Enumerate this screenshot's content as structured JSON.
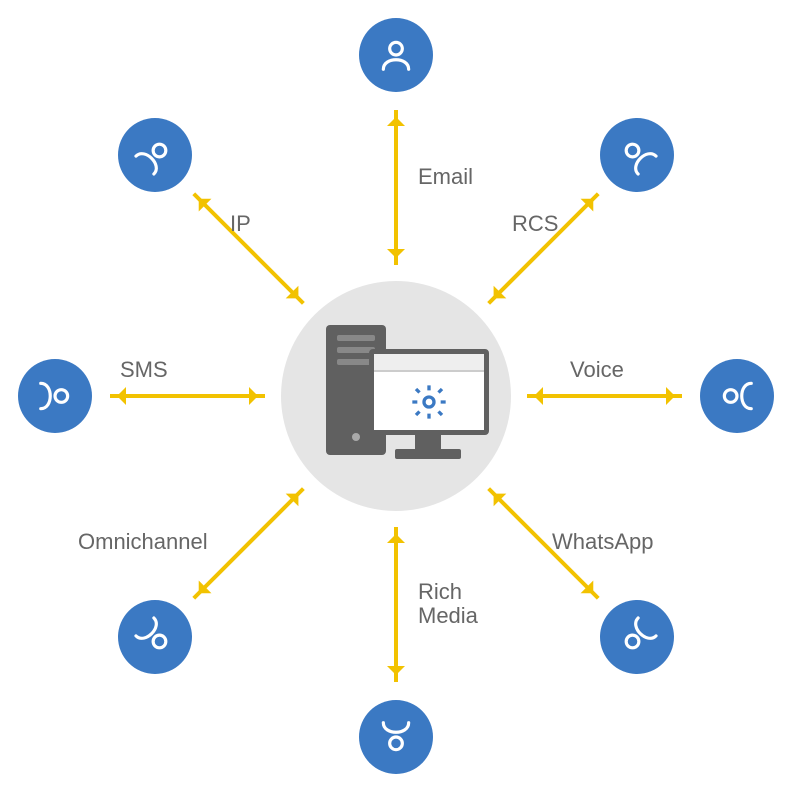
{
  "diagram": {
    "center": {
      "name": "server-computer-hub"
    },
    "channels": [
      {
        "key": "email",
        "label": "Email",
        "angle": -90
      },
      {
        "key": "rcs",
        "label": "RCS",
        "angle": -45
      },
      {
        "key": "voice",
        "label": "Voice",
        "angle": 0
      },
      {
        "key": "whatsapp",
        "label": "WhatsApp",
        "angle": 45
      },
      {
        "key": "richmedia",
        "label": "Rich\nMedia",
        "angle": 90
      },
      {
        "key": "omnichannel",
        "label": "Omnichannel",
        "angle": 135
      },
      {
        "key": "sms",
        "label": "SMS",
        "angle": 180
      },
      {
        "key": "ip",
        "label": "IP",
        "angle": -135
      }
    ]
  },
  "colors": {
    "accent": "#3b79c3",
    "arrow": "#f2c200",
    "hub": "#e5e5e5",
    "text": "#666"
  }
}
